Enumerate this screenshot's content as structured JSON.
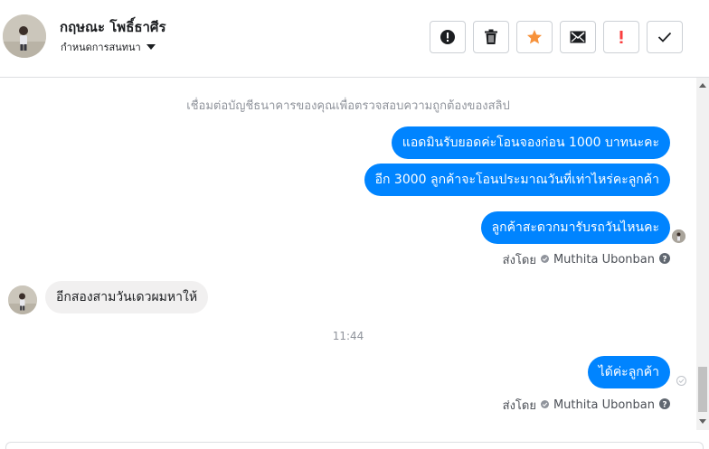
{
  "contact": {
    "name": "กฤษณะ โพธิ์ธาศีร",
    "assign_label": "กำหนดการสนทนา"
  },
  "icons": {
    "header_avatar": "child-photo-avatar",
    "assign_caret": "caret-down-icon",
    "spam": "exclamation-circle-icon",
    "trash": "trash-icon",
    "star": "star-icon",
    "mail": "envelope-icon",
    "important": "exclamation-icon",
    "done": "checkmark-icon"
  },
  "colors": {
    "outgoing_bubble": "#0084ff",
    "incoming_bubble": "#f1f0f0",
    "star": "#f7923b",
    "important": "#fa3e3e"
  },
  "thread": {
    "notice": "เชื่อมต่อบัญชีธนาคารของคุณเพื่อตรวจสอบความถูกต้องของสลิป",
    "messages_block1": [
      "แอดมินรับยอดค่ะโอนจองก่อน 1000 บาทนะคะ",
      "อีก 3000 ลูกค้าจะโอนประมาณวันที่เท่าไหร่คะลูกค้า"
    ],
    "message_single": "ลูกค้าสะดวกมารับรถวันไหนคะ",
    "sent_by_prefix": "ส่งโดย",
    "sent_by_name": "Muthita Ubonban",
    "incoming_message": "อีกสองสามวันเดวผมหาให้",
    "timestamp": "11:44",
    "last_message": "ได้ค่ะลูกค้า"
  }
}
